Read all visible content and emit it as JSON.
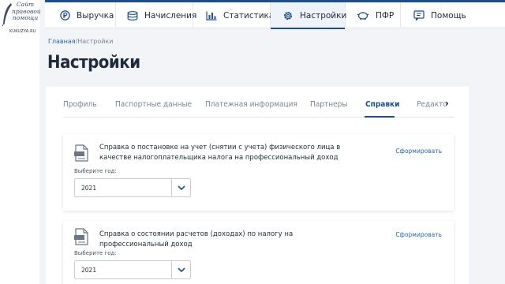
{
  "logo": {
    "lines": [
      "Сайт",
      "правовой",
      "помощи"
    ],
    "site": "KUKUZYA.RU"
  },
  "nav": {
    "items": [
      {
        "label": "Выручка",
        "icon": "ruble-coin-icon"
      },
      {
        "label": "Начисления",
        "icon": "coins-stack-icon"
      },
      {
        "label": "Статистика",
        "icon": "bar-chart-icon"
      },
      {
        "label": "Настройки",
        "icon": "gear-icon",
        "active": true
      },
      {
        "label": "ПФР",
        "icon": "piggy-bank-icon"
      },
      {
        "label": "Помощь",
        "icon": "chat-help-icon"
      }
    ]
  },
  "breadcrumb": {
    "home": "Главная",
    "separator": "/",
    "current": "Настройки"
  },
  "page_title": "Настройки",
  "tabs": {
    "items": [
      "Профиль",
      "Паспортные данные",
      "Платежная информация",
      "Партнеры",
      "Справки",
      "Редакто"
    ],
    "active": "Справки"
  },
  "cards": [
    {
      "title": "Справка о постановке на учет (снятии с учета) физического лица в качестве налогоплательщика налога на профессиональный доход",
      "action": "Сформировать",
      "year_label": "Выберите год:",
      "year_value": "2021"
    },
    {
      "title": "Справка о состоянии расчетов (доходах) по налогу на профессиональный доход",
      "action": "Сформировать",
      "year_label": "Выберите год:",
      "year_value": "2021"
    }
  ],
  "colors": {
    "accent": "#1d4e89",
    "link": "#2c66a8",
    "background": "#f2f4f7"
  }
}
